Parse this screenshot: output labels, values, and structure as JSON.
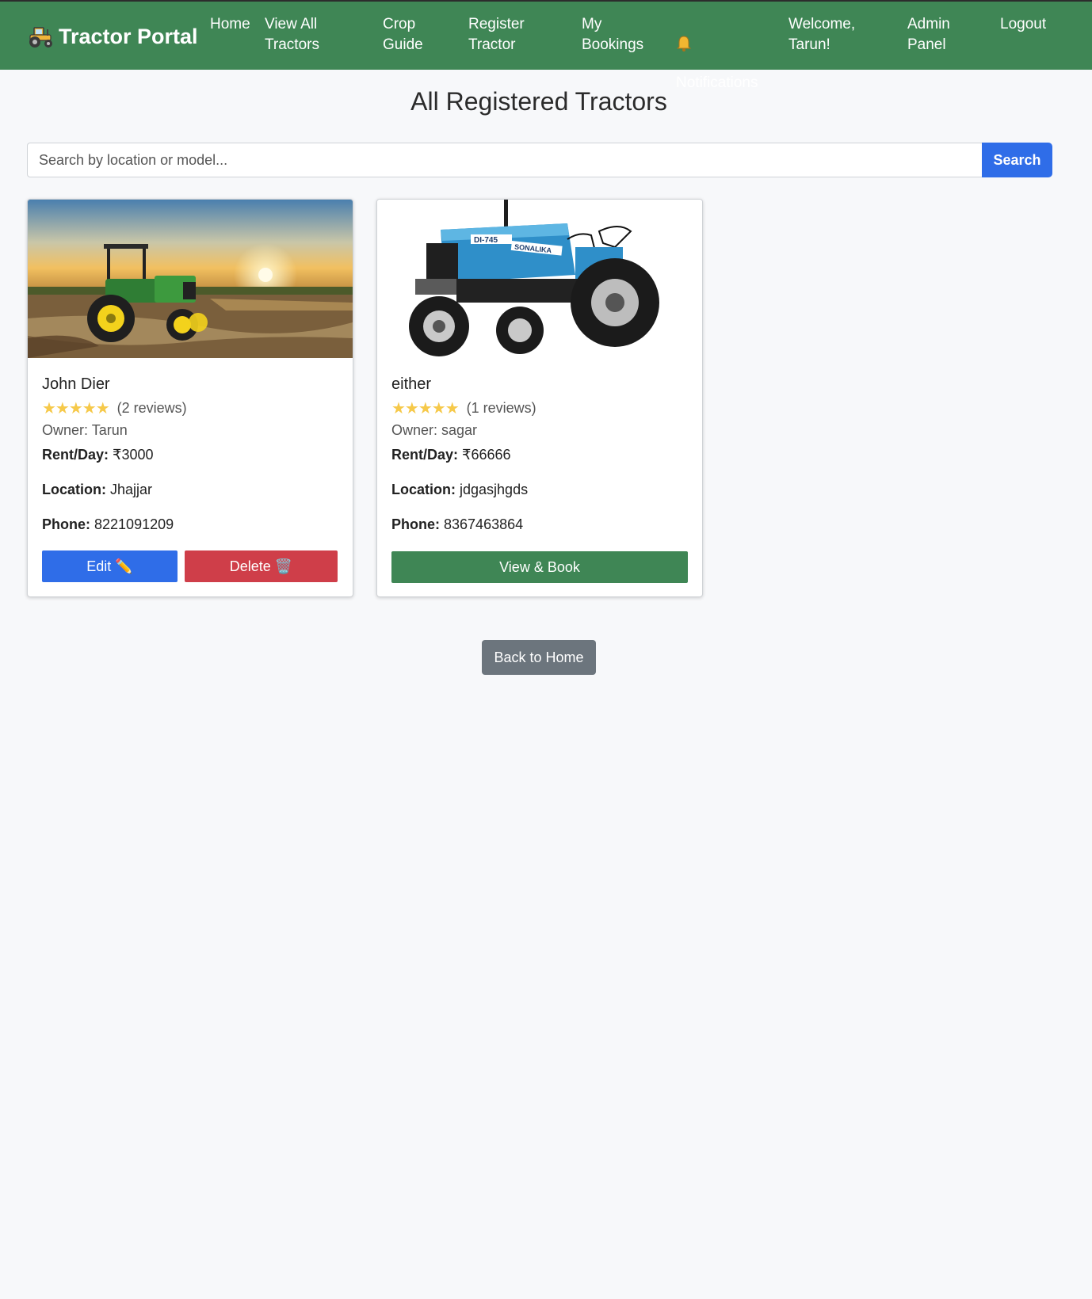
{
  "navbar": {
    "brand": "Tractor Portal",
    "brand_icon": "tractor-icon",
    "items": [
      {
        "label": "Home"
      },
      {
        "label": "View All\nTractors"
      },
      {
        "label": "Crop\nGuide"
      },
      {
        "label": "Register\nTractor"
      },
      {
        "label": "My\nBookings"
      },
      {
        "label": "Notifications",
        "icon": "bell-icon"
      },
      {
        "label": "Welcome,\nTarun!"
      },
      {
        "label": "Admin\nPanel"
      },
      {
        "label": "Logout"
      }
    ]
  },
  "page": {
    "title": "All Registered Tractors"
  },
  "search": {
    "placeholder": "Search by location or model...",
    "button": "Search"
  },
  "tractors": [
    {
      "name": "John Dier",
      "stars": "★★★★★",
      "reviews": "(2 reviews)",
      "owner": "Owner: Tarun",
      "rent_label": "Rent/Day:",
      "rent": "₹3000",
      "location_label": "Location:",
      "location": "Jhajjar",
      "phone_label": "Phone:",
      "phone": "8221091209",
      "edit_label": "Edit ✏️",
      "delete_label": "Delete 🗑️"
    },
    {
      "name": "either",
      "stars": "★★★★★",
      "reviews": "(1 reviews)",
      "owner": "Owner: sagar",
      "rent_label": "Rent/Day:",
      "rent": "₹66666",
      "location_label": "Location:",
      "location": "jdgasjhgds",
      "phone_label": "Phone:",
      "phone": "8367463864",
      "book_label": "View & Book",
      "image_text": "DI-745",
      "image_brand": "SONALIKA"
    }
  ],
  "back_button": "Back to Home",
  "colors": {
    "nav": "#3f8655",
    "primary": "#2f6de8",
    "danger": "#cf3e49",
    "secondary": "#6c757d",
    "star": "#f6c94a"
  }
}
